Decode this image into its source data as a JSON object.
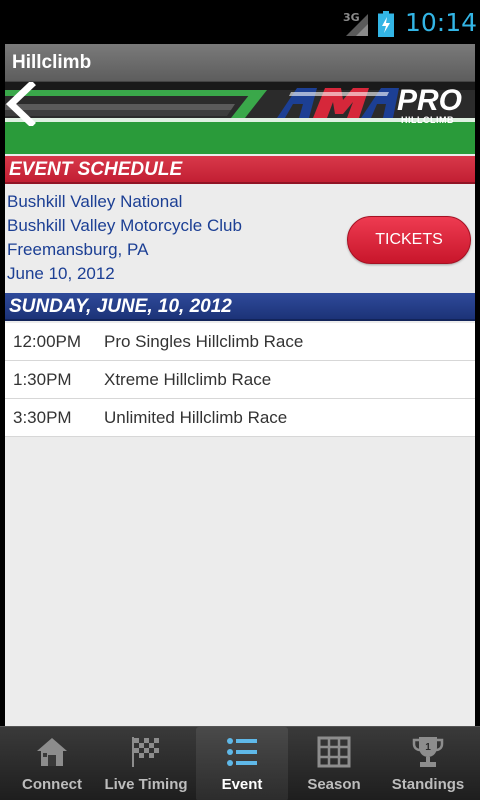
{
  "status_bar": {
    "network": "3G",
    "time": "10:14"
  },
  "title_bar": {
    "title": "Hillclimb"
  },
  "banner": {
    "logo_ama": "AMA",
    "logo_pro": "PRO",
    "logo_sub": "HILLCLIMB"
  },
  "event_schedule": {
    "header": "EVENT SCHEDULE",
    "name": "Bushkill Valley National",
    "club": "Bushkill Valley Motorcycle Club",
    "location": "Freemansburg, PA",
    "date": "June 10, 2012",
    "tickets_label": "TICKETS"
  },
  "day": {
    "header": "SUNDAY, JUNE, 10, 2012",
    "items": [
      {
        "time": "12:00PM",
        "name": "Pro Singles Hillclimb Race"
      },
      {
        "time": "1:30PM",
        "name": "Xtreme Hillclimb Race"
      },
      {
        "time": "3:30PM",
        "name": "Unlimited Hillclimb Race"
      }
    ]
  },
  "tabs": [
    {
      "label": "Connect",
      "icon": "house-icon"
    },
    {
      "label": "Live Timing",
      "icon": "checkered-flag-icon"
    },
    {
      "label": "Event",
      "icon": "list-icon",
      "active": true
    },
    {
      "label": "Season",
      "icon": "grid-icon"
    },
    {
      "label": "Standings",
      "icon": "trophy-icon"
    }
  ],
  "colors": {
    "accent_red": "#c21f33",
    "accent_blue": "#1c3378",
    "text_blue": "#1c3f94",
    "status_time": "#33b5e5"
  }
}
